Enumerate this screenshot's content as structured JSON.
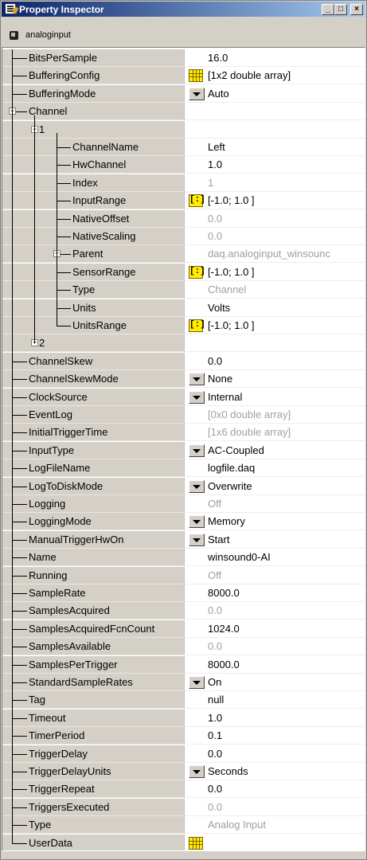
{
  "window": {
    "title": "Property Inspector",
    "minimize": "_",
    "maximize": "□",
    "close": "×"
  },
  "object": {
    "label": "analoginput"
  },
  "rows": [
    {
      "name": "BitsPerSample",
      "value": "16.0",
      "depth": 0,
      "icon": null,
      "ro": false
    },
    {
      "name": "BufferingConfig",
      "value": "[1x2  double array]",
      "depth": 0,
      "icon": "array-icon",
      "ro": false
    },
    {
      "name": "BufferingMode",
      "value": "Auto",
      "depth": 0,
      "icon": "dropdown-icon",
      "ro": false
    },
    {
      "name": "Channel",
      "value": "",
      "depth": 0,
      "icon": null,
      "ro": false,
      "expander": "−"
    },
    {
      "name": "1",
      "value": "",
      "depth": 1,
      "icon": null,
      "ro": false,
      "expander": "−"
    },
    {
      "name": "ChannelName",
      "value": "Left",
      "depth": 2,
      "icon": null,
      "ro": false
    },
    {
      "name": "HwChannel",
      "value": "1.0",
      "depth": 2,
      "icon": null,
      "ro": false
    },
    {
      "name": "Index",
      "value": "1",
      "depth": 2,
      "icon": null,
      "ro": true
    },
    {
      "name": "InputRange",
      "value": "[-1.0; 1.0 ]",
      "depth": 2,
      "icon": "vector-icon",
      "ro": false
    },
    {
      "name": "NativeOffset",
      "value": "0.0",
      "depth": 2,
      "icon": null,
      "ro": true
    },
    {
      "name": "NativeScaling",
      "value": "0.0",
      "depth": 2,
      "icon": null,
      "ro": true
    },
    {
      "name": "Parent",
      "value": "daq.analoginput_winsounc",
      "depth": 2,
      "icon": null,
      "ro": true,
      "expander": "+"
    },
    {
      "name": "SensorRange",
      "value": "[-1.0; 1.0 ]",
      "depth": 2,
      "icon": "vector-icon",
      "ro": false
    },
    {
      "name": "Type",
      "value": "Channel",
      "depth": 2,
      "icon": null,
      "ro": true
    },
    {
      "name": "Units",
      "value": "Volts",
      "depth": 2,
      "icon": null,
      "ro": false
    },
    {
      "name": "UnitsRange",
      "value": "[-1.0; 1.0 ]",
      "depth": 2,
      "icon": "vector-icon",
      "ro": false
    },
    {
      "name": "2",
      "value": "",
      "depth": 1,
      "icon": null,
      "ro": false,
      "expander": "+"
    },
    {
      "name": "ChannelSkew",
      "value": "0.0",
      "depth": 0,
      "icon": null,
      "ro": false
    },
    {
      "name": "ChannelSkewMode",
      "value": "None",
      "depth": 0,
      "icon": "dropdown-icon",
      "ro": false
    },
    {
      "name": "ClockSource",
      "value": "Internal",
      "depth": 0,
      "icon": "dropdown-icon",
      "ro": false
    },
    {
      "name": "EventLog",
      "value": "[0x0  double array]",
      "depth": 0,
      "icon": null,
      "ro": true
    },
    {
      "name": "InitialTriggerTime",
      "value": "[1x6  double array]",
      "depth": 0,
      "icon": null,
      "ro": true
    },
    {
      "name": "InputType",
      "value": "AC-Coupled",
      "depth": 0,
      "icon": "dropdown-icon",
      "ro": false
    },
    {
      "name": "LogFileName",
      "value": "logfile.daq",
      "depth": 0,
      "icon": null,
      "ro": false
    },
    {
      "name": "LogToDiskMode",
      "value": "Overwrite",
      "depth": 0,
      "icon": "dropdown-icon",
      "ro": false
    },
    {
      "name": "Logging",
      "value": "Off",
      "depth": 0,
      "icon": null,
      "ro": true
    },
    {
      "name": "LoggingMode",
      "value": "Memory",
      "depth": 0,
      "icon": "dropdown-icon",
      "ro": false
    },
    {
      "name": "ManualTriggerHwOn",
      "value": "Start",
      "depth": 0,
      "icon": "dropdown-icon",
      "ro": false
    },
    {
      "name": "Name",
      "value": "winsound0-AI",
      "depth": 0,
      "icon": null,
      "ro": false
    },
    {
      "name": "Running",
      "value": "Off",
      "depth": 0,
      "icon": null,
      "ro": true
    },
    {
      "name": "SampleRate",
      "value": "8000.0",
      "depth": 0,
      "icon": null,
      "ro": false
    },
    {
      "name": "SamplesAcquired",
      "value": "0.0",
      "depth": 0,
      "icon": null,
      "ro": true
    },
    {
      "name": "SamplesAcquiredFcnCount",
      "value": "1024.0",
      "depth": 0,
      "icon": null,
      "ro": false
    },
    {
      "name": "SamplesAvailable",
      "value": "0.0",
      "depth": 0,
      "icon": null,
      "ro": true
    },
    {
      "name": "SamplesPerTrigger",
      "value": "8000.0",
      "depth": 0,
      "icon": null,
      "ro": false
    },
    {
      "name": "StandardSampleRates",
      "value": "On",
      "depth": 0,
      "icon": "dropdown-icon",
      "ro": false
    },
    {
      "name": "Tag",
      "value": "null",
      "depth": 0,
      "icon": null,
      "ro": false
    },
    {
      "name": "Timeout",
      "value": "1.0",
      "depth": 0,
      "icon": null,
      "ro": false
    },
    {
      "name": "TimerPeriod",
      "value": "0.1",
      "depth": 0,
      "icon": null,
      "ro": false
    },
    {
      "name": "TriggerDelay",
      "value": "0.0",
      "depth": 0,
      "icon": null,
      "ro": false
    },
    {
      "name": "TriggerDelayUnits",
      "value": "Seconds",
      "depth": 0,
      "icon": "dropdown-icon",
      "ro": false
    },
    {
      "name": "TriggerRepeat",
      "value": "0.0",
      "depth": 0,
      "icon": null,
      "ro": false
    },
    {
      "name": "TriggersExecuted",
      "value": "0.0",
      "depth": 0,
      "icon": null,
      "ro": true
    },
    {
      "name": "Type",
      "value": "Analog Input",
      "depth": 0,
      "icon": null,
      "ro": true
    },
    {
      "name": "UserData",
      "value": "",
      "depth": 0,
      "icon": "array-icon",
      "ro": false
    }
  ]
}
